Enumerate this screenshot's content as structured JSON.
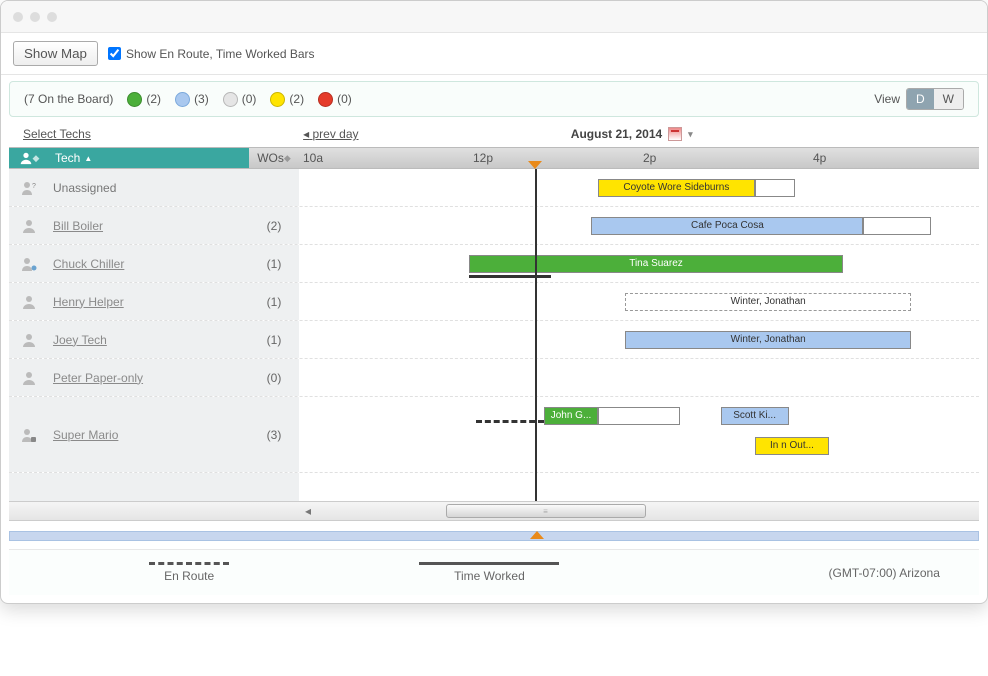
{
  "toolbar": {
    "show_map": "Show Map",
    "show_bars": "Show En Route, Time Worked Bars"
  },
  "status": {
    "on_board": "(7 On the Board)",
    "counts": {
      "green": "(2)",
      "blue": "(3)",
      "gray": "(0)",
      "yellow": "(2)",
      "red": "(0)"
    },
    "view_label": "View",
    "view_day": "D",
    "view_week": "W"
  },
  "nav": {
    "select_techs": "Select Techs",
    "prev_day": "prev day",
    "date": "August 21, 2014"
  },
  "header": {
    "tech": "Tech",
    "wos": "WOs",
    "times": [
      "10a",
      "12p",
      "2p",
      "4p"
    ]
  },
  "rows": [
    {
      "name": "Unassigned",
      "wos": ""
    },
    {
      "name": "Bill Boiler",
      "wos": "(2)"
    },
    {
      "name": "Chuck Chiller",
      "wos": "(1)"
    },
    {
      "name": "Henry Helper",
      "wos": "(1)"
    },
    {
      "name": "Joey Tech",
      "wos": "(1)"
    },
    {
      "name": "Peter Paper-only",
      "wos": "(0)"
    },
    {
      "name": "Super Mario",
      "wos": "(3)"
    }
  ],
  "bars": {
    "coyote": "Coyote Wore Sideburns",
    "cafe": "Cafe Poca Cosa",
    "tina": "Tina Suarez",
    "winter1": "Winter, Jonathan",
    "winter2": "Winter, Jonathan",
    "john": "John G...",
    "scott": "Scott Ki...",
    "inout": "In n Out..."
  },
  "legend": {
    "en_route": "En Route",
    "time_worked": "Time Worked",
    "timezone": "(GMT-07:00) Arizona"
  }
}
